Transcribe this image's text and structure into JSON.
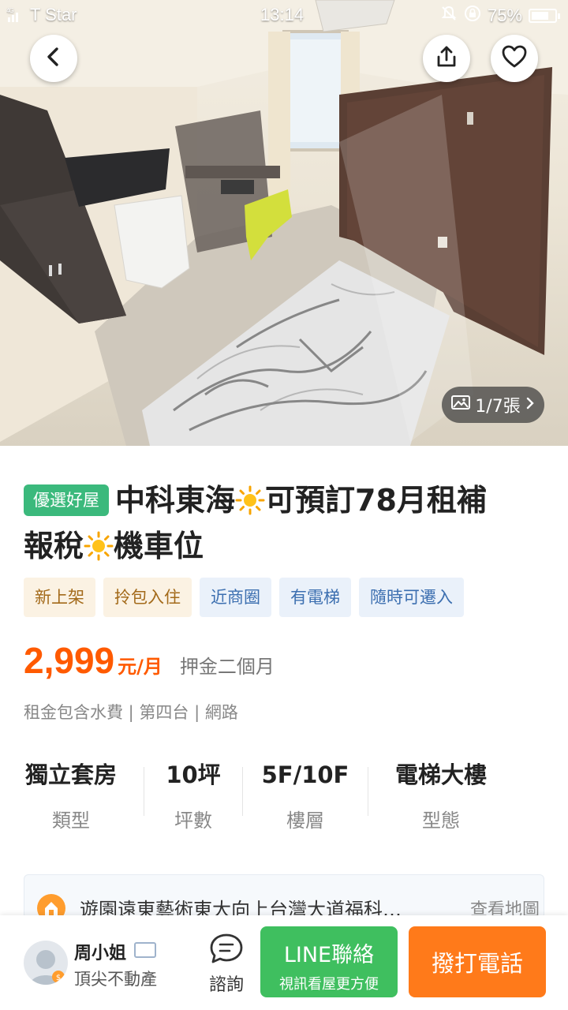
{
  "status_bar": {
    "carrier": "T Star",
    "network": "4G",
    "time": "13:14",
    "battery": "75%",
    "battery_level": 0.75
  },
  "photo": {
    "counter": "1/7張"
  },
  "listing": {
    "badge": "優選好屋",
    "title_parts": [
      "中科東海",
      "可預訂78月租補",
      "報稅",
      "機車位"
    ],
    "tags": [
      "新上架",
      "拎包入住",
      "近商圈",
      "有電梯",
      "隨時可遷入"
    ],
    "price": "2,999",
    "price_unit": "元/月",
    "deposit": "押金二個月",
    "fees": "租金包含水費 | 第四台 | 網路",
    "specs": [
      {
        "value": "獨立套房",
        "label": "類型"
      },
      {
        "value": "10坪",
        "label": "坪數"
      },
      {
        "value": "5F/10F",
        "label": "樓層"
      },
      {
        "value": "電梯大樓",
        "label": "型態"
      }
    ],
    "address": "遊園遠東藝術東大向上台灣大道福科…",
    "address_more": "查看地圖"
  },
  "agent": {
    "name": "周小姐",
    "company": "頂尖不動產"
  },
  "actions": {
    "consult": "諮詢",
    "line_title": "LINE聯絡",
    "line_sub": "視訊看屋更方便",
    "call": "撥打電話"
  },
  "colors": {
    "accent": "#ff5a00",
    "badge": "#3bb97c",
    "line": "#3fbf5f",
    "call": "#ff7a1a"
  },
  "icons": [
    "back-icon",
    "share-icon",
    "heart-icon",
    "image-icon",
    "chevron-right-icon",
    "sun-icon",
    "location-icon",
    "chat-icon",
    "id-card-icon"
  ]
}
